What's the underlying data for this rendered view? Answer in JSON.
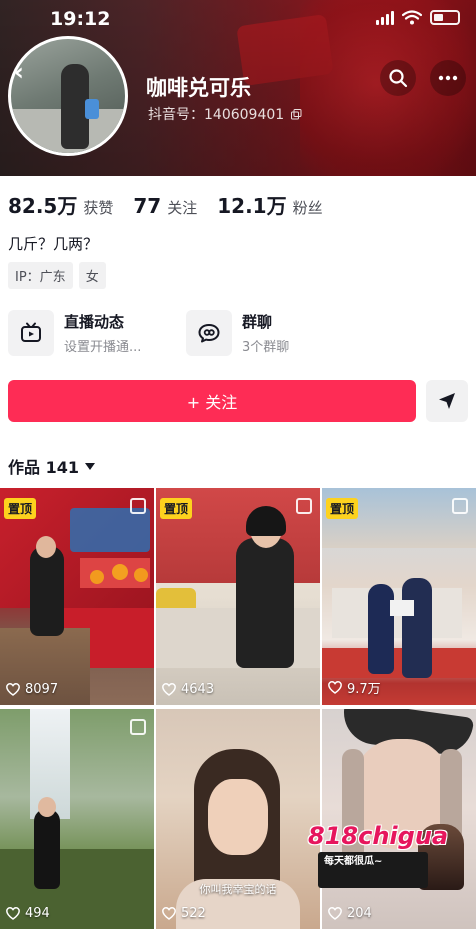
{
  "status_bar": {
    "time": "19:12"
  },
  "profile": {
    "nickname": "咖啡兑可乐",
    "douyin_id": "抖音号：140609401"
  },
  "stats": [
    {
      "value": "82.5万",
      "label": "获赞"
    },
    {
      "value": "77",
      "label": "关注"
    },
    {
      "value": "12.1万",
      "label": "粉丝"
    }
  ],
  "bio": "几斤？几两？",
  "tags": [
    "IP：广东",
    "女"
  ],
  "features": [
    {
      "title": "直播动态",
      "subtitle": "设置开播通...",
      "icon": "tv-icon"
    },
    {
      "title": "群聊",
      "subtitle": "3个群聊",
      "icon": "chat-bubble-icon"
    }
  ],
  "follow_label": "+ 关注",
  "works_tab": "作品 141",
  "grid": [
    {
      "pinned": true,
      "pin_label": "置顶",
      "likes": "8097"
    },
    {
      "pinned": true,
      "pin_label": "置顶",
      "likes": "4643"
    },
    {
      "pinned": true,
      "pin_label": "置顶",
      "likes": "9.7万"
    },
    {
      "pinned": false,
      "likes": "494"
    },
    {
      "pinned": false,
      "likes": "522",
      "caption": "你叫我幸宝的话"
    },
    {
      "pinned": false,
      "likes": "204"
    }
  ],
  "watermark": {
    "logo": "818chigua",
    "line1": "每天都很瓜~"
  },
  "colors": {
    "accent": "#fe2c55",
    "pin": "#fdd21e"
  }
}
